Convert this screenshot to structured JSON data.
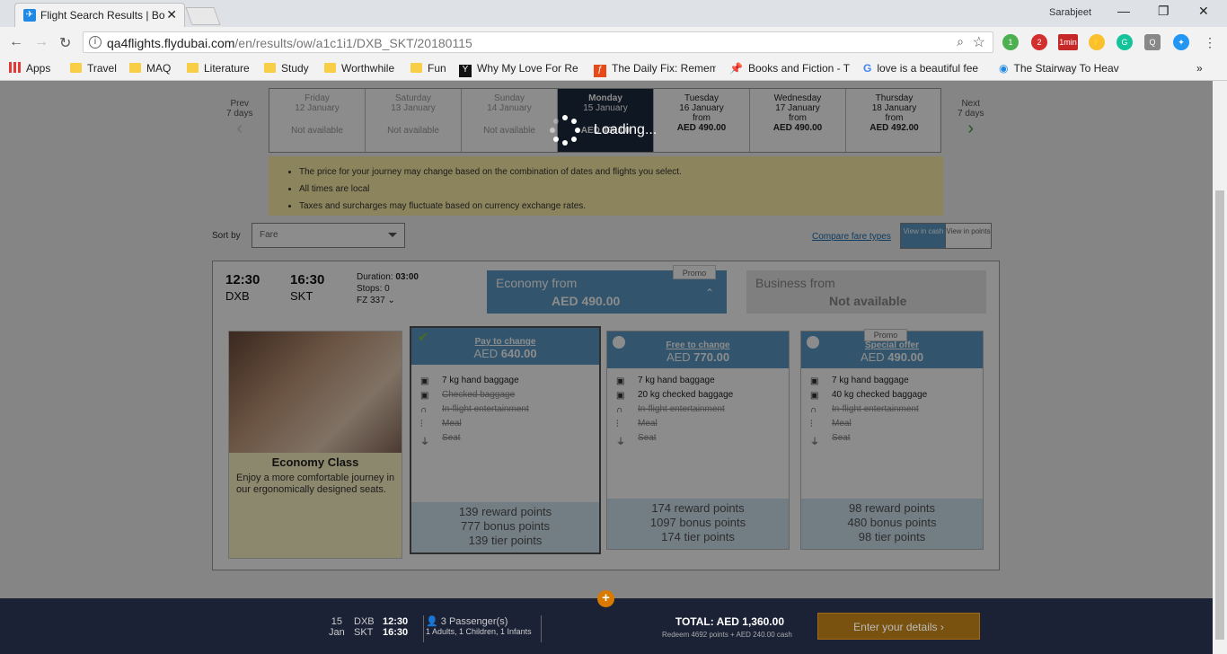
{
  "browser": {
    "tab_title": "Flight Search Results | Bo",
    "user": "Sarabjeet",
    "url_host": "qa4flights.flydubai.com",
    "url_path": "/en/results/ow/a1c1i1/DXB_SKT/20180115",
    "bookmarks": [
      "Apps",
      "Travel",
      "MAQ",
      "Literature",
      "Study",
      "Worthwhile",
      "Fun",
      "Why My Love For Re",
      "The Daily Fix: Remem",
      "Books and Fiction - T",
      "love is a beautiful fee",
      "The Stairway To Heav"
    ],
    "ext_badges": [
      "1",
      "2",
      "1min"
    ]
  },
  "dates": {
    "prev": {
      "label": "Prev",
      "sub": "7 days"
    },
    "next": {
      "label": "Next",
      "sub": "7 days"
    },
    "days": [
      {
        "day": "Friday",
        "date": "12 January",
        "status": "Not available"
      },
      {
        "day": "Saturday",
        "date": "13 January",
        "status": "Not available"
      },
      {
        "day": "Sunday",
        "date": "14 January",
        "status": "Not available"
      },
      {
        "day": "Monday",
        "date": "15 January",
        "status": "",
        "amount": "AED 490.00"
      },
      {
        "day": "Tuesday",
        "date": "16 January",
        "status": "from",
        "amount": "AED 490.00"
      },
      {
        "day": "Wednesday",
        "date": "17 January",
        "status": "from",
        "amount": "AED 490.00"
      },
      {
        "day": "Thursday",
        "date": "18 January",
        "status": "from",
        "amount": "AED 492.00"
      }
    ]
  },
  "notice": [
    "The price for your journey may change based on the combination of dates and flights you select.",
    "All times are local",
    "Taxes and surcharges may fluctuate based on currency exchange rates."
  ],
  "sort": {
    "label": "Sort by",
    "value": "Fare"
  },
  "compare_link": "Compare fare types",
  "view": {
    "cash": "View in cash",
    "points": "View in points"
  },
  "loading": "Loading...",
  "flight": {
    "dep_time": "12:30",
    "dep_ap": "DXB",
    "arr_time": "16:30",
    "arr_ap": "SKT",
    "duration_label": "Duration:",
    "duration": "03:00",
    "stops": "Stops: 0",
    "flight_no": "FZ 337",
    "economy": {
      "label": "Economy from",
      "price": "AED 490.00",
      "promo": "Promo"
    },
    "business": {
      "label": "Business from",
      "price": "Not available"
    },
    "economy_card": {
      "title": "Economy Class",
      "desc": "Enjoy a more comfortable journey in our ergonomically designed seats."
    },
    "fares": [
      {
        "name": "Pay to change",
        "currency": "AED",
        "price": "640.00",
        "features": [
          "7 kg hand baggage",
          "Checked baggage",
          "In-flight entertainment",
          "Meal",
          "Seat"
        ],
        "points": [
          "139 reward points",
          "777 bonus points",
          "139 tier points"
        ]
      },
      {
        "name": "Free to change",
        "currency": "AED",
        "price": "770.00",
        "features": [
          "7 kg hand baggage",
          "20 kg checked baggage",
          "In-flight entertainment",
          "Meal",
          "Seat"
        ],
        "points": [
          "174 reward points",
          "1097 bonus points",
          "174 tier points"
        ]
      },
      {
        "name": "Special offer",
        "promo": "Promo",
        "currency": "AED",
        "price": "490.00",
        "features": [
          "7 kg hand baggage",
          "40 kg checked baggage",
          "In-flight entertainment",
          "Meal",
          "Seat"
        ],
        "points": [
          "98 reward points",
          "480 bonus points",
          "98 tier points"
        ]
      }
    ]
  },
  "footer": {
    "day": "15",
    "month": "Jan",
    "from": "DXB",
    "to": "SKT",
    "dep": "12:30",
    "arr": "16:30",
    "pax": "3 Passenger(s)",
    "pax_detail": "1 Adults, 1 Children, 1 Infants",
    "total": "TOTAL: AED 1,360.00",
    "redeem": "Redeem 4692 points + AED 240.00 cash",
    "cta": "Enter your details ›"
  }
}
